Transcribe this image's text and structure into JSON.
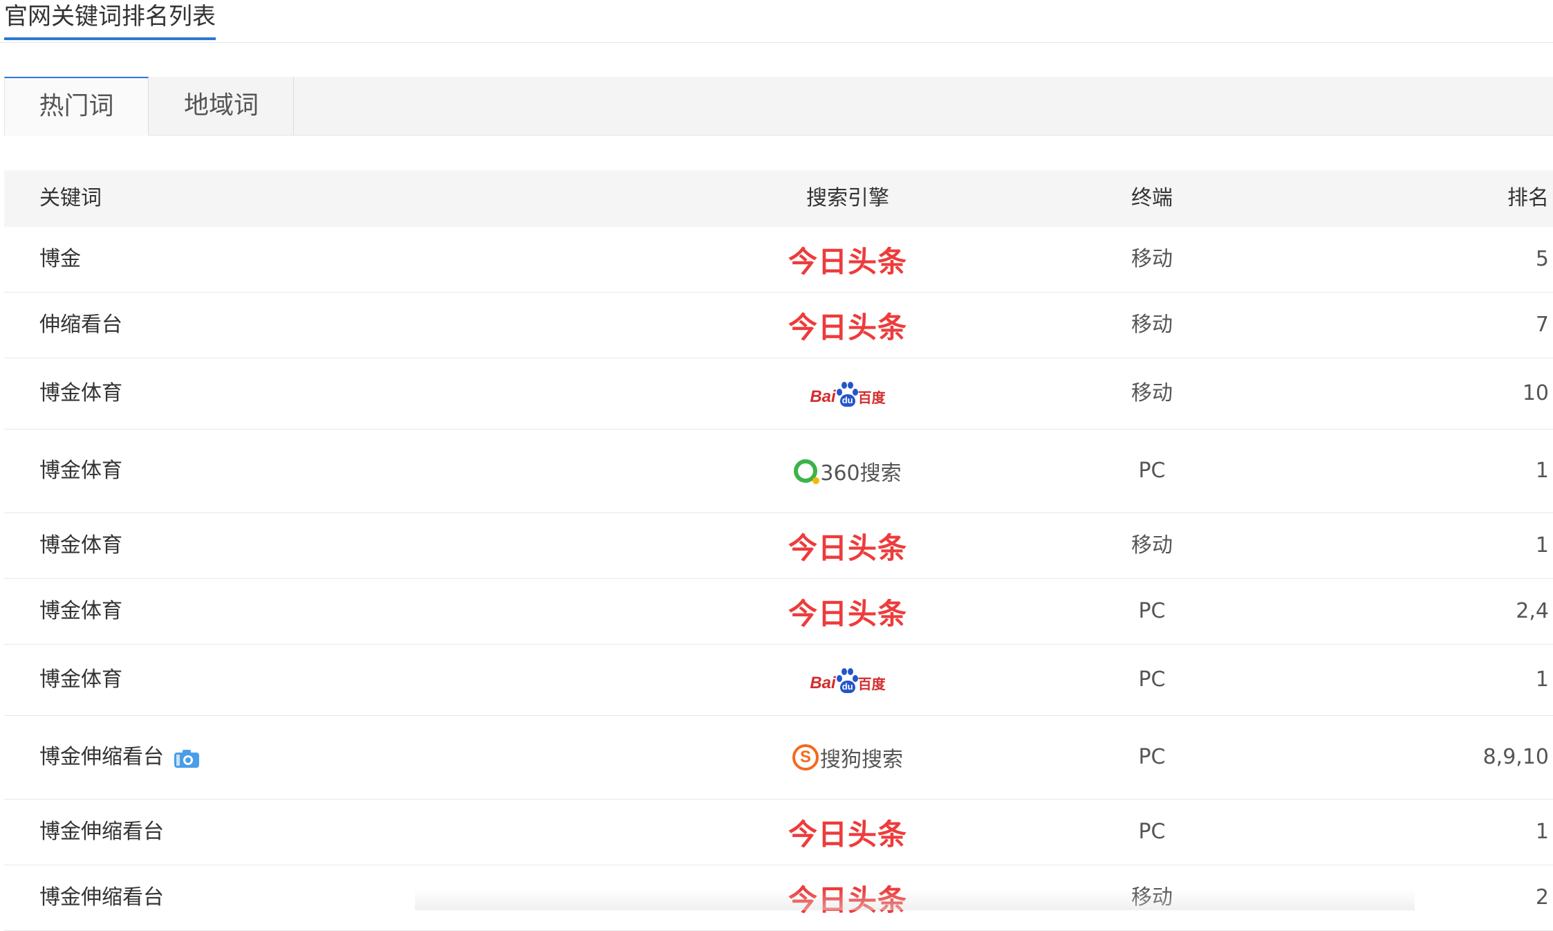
{
  "page": {
    "title": "官网关键词排名列表"
  },
  "tabs": [
    {
      "label": "热门词",
      "active": true
    },
    {
      "label": "地域词",
      "active": false
    }
  ],
  "table": {
    "headers": {
      "keyword": "关键词",
      "engine": "搜索引擎",
      "terminal": "终端",
      "rank": "排名"
    },
    "rows": [
      {
        "keyword": "博金",
        "engine": "今日头条",
        "engine_icon": "toutiao-logo",
        "terminal": "移动",
        "rank": "5"
      },
      {
        "keyword": "伸缩看台",
        "engine": "今日头条",
        "engine_icon": "toutiao-logo",
        "terminal": "移动",
        "rank": "7"
      },
      {
        "keyword": "博金体育",
        "engine": "百度",
        "engine_text_en": "Bai",
        "engine_text_paw": "du",
        "engine_icon": "baidu-logo",
        "terminal": "移动",
        "rank": "10"
      },
      {
        "keyword": "博金体育",
        "engine": "360搜索",
        "engine_icon": "360-logo",
        "terminal": "PC",
        "rank": "1"
      },
      {
        "keyword": "博金体育",
        "engine": "今日头条",
        "engine_icon": "toutiao-logo",
        "terminal": "移动",
        "rank": "1"
      },
      {
        "keyword": "博金体育",
        "engine": "今日头条",
        "engine_icon": "toutiao-logo",
        "terminal": "PC",
        "rank": "2,4"
      },
      {
        "keyword": "博金体育",
        "engine": "百度",
        "engine_text_en": "Bai",
        "engine_text_paw": "du",
        "engine_icon": "baidu-logo",
        "terminal": "PC",
        "rank": "1"
      },
      {
        "keyword": "博金伸缩看台",
        "engine": "搜狗搜索",
        "engine_icon": "sogou-logo",
        "engine_badge": "S",
        "terminal": "PC",
        "rank": "8,9,10",
        "has_camera_icon": true
      },
      {
        "keyword": "博金伸缩看台",
        "engine": "今日头条",
        "engine_icon": "toutiao-logo",
        "terminal": "PC",
        "rank": "1"
      },
      {
        "keyword": "博金伸缩看台",
        "engine": "今日头条",
        "engine_icon": "toutiao-logo",
        "terminal": "移动",
        "rank": "2"
      }
    ]
  },
  "colors": {
    "accent": "#2b78d4",
    "toutiao_red": "#ee3b3b",
    "baidu_red": "#d42c2c",
    "baidu_blue": "#2455c9",
    "so360_green": "#3cb34a",
    "sogou_orange": "#f26a1b"
  }
}
